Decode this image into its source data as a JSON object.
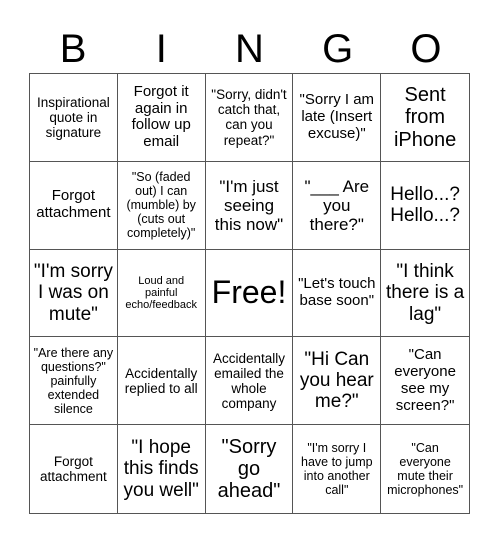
{
  "header": {
    "letters": [
      "B",
      "I",
      "N",
      "G",
      "O"
    ]
  },
  "grid": {
    "rows": [
      [
        "Inspirational quote in signature",
        "Forgot it again in follow up email",
        "\"Sorry, didn't catch that, can you repeat?\"",
        "\"Sorry I am late (Insert excuse)\"",
        "Sent from iPhone"
      ],
      [
        "Forgot attachment",
        "\"So (faded out) I can (mumble) by (cuts out completely)\"",
        "\"I'm just seeing this now\"",
        "\"___ Are you there?\"",
        "Hello...? Hello...?"
      ],
      [
        "\"I'm sorry I was on mute\"",
        "Loud and painful echo/feedback",
        "Free!",
        "\"Let's touch base soon\"",
        "\"I think there is a lag\""
      ],
      [
        "\"Are there any questions?\" painfully extended silence",
        "Accidentally replied to all",
        "Accidentally emailed the whole company",
        "\"Hi Can you hear me?\"",
        "\"Can everyone see my screen?\""
      ],
      [
        "Forgot attachment",
        "\"I hope this finds you well\"",
        "\"Sorry go ahead\"",
        "\"I'm sorry I have to jump into another call\"",
        "\"Can everyone mute their microphones\""
      ]
    ]
  }
}
